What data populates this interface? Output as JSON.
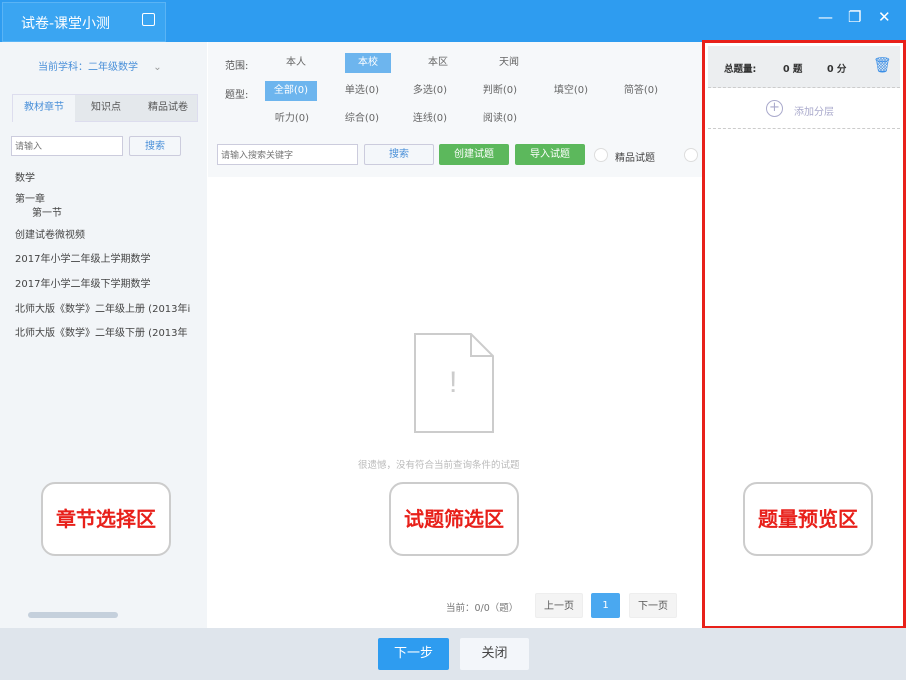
{
  "window": {
    "title": "试卷-课堂小测"
  },
  "left": {
    "subject": "当前学科：二年级数学",
    "tabs": [
      "教材章节",
      "知识点",
      "精品试卷"
    ],
    "search_placeholder": "请输入",
    "search_btn": "搜索",
    "tree": [
      "数学",
      "第一章",
      "第一节",
      "创建试卷微视频",
      "2017年小学二年级上学期数学",
      "2017年小学二年级下学期数学",
      "北师大版《数学》二年级上册 (2013年i",
      "北师大版《数学》二年级下册 (2013年"
    ]
  },
  "filters": {
    "scope_label": "范围:",
    "scope": [
      "本人",
      "本校",
      "本区",
      "天闻"
    ],
    "type_label": "题型:",
    "types": [
      "全部(0)",
      "单选(0)",
      "多选(0)",
      "判断(0)",
      "填空(0)",
      "简答(0)",
      "听力(0)",
      "综合(0)",
      "连线(0)",
      "阅读(0)"
    ],
    "search_placeholder": "请输入搜索关键字",
    "search_btn": "搜索",
    "create_btn": "创建试题",
    "import_btn": "导入试题",
    "premium_label": "精品试题"
  },
  "empty_message": "很遗憾，没有符合当前查询条件的试题",
  "pager": {
    "status": "当前：0/0（题）",
    "prev": "上一页",
    "page": "1",
    "next": "下一页"
  },
  "preview": {
    "total_label": "总题量:",
    "count": "0 题",
    "score": "0 分",
    "add_layer": "添加分层"
  },
  "callouts": {
    "left": "章节选择区",
    "mid": "试题筛选区",
    "right": "题量预览区"
  },
  "footer": {
    "next": "下一步",
    "close": "关闭"
  }
}
